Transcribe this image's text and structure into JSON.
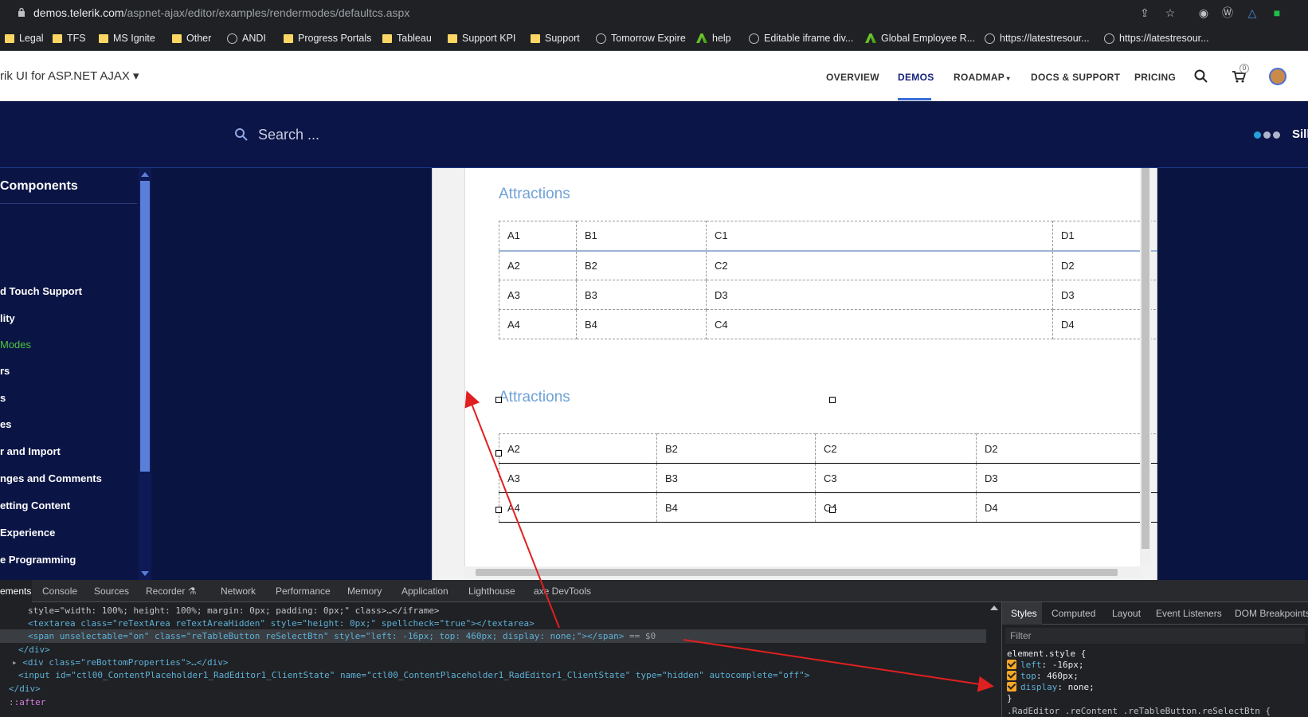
{
  "browser": {
    "url_host": "demos.telerik.com",
    "url_path": "/aspnet-ajax/editor/examples/rendermodes/defaultcs.aspx",
    "bookmarks": [
      {
        "label": "Legal",
        "icon": "folder-icon"
      },
      {
        "label": "TFS",
        "icon": "folder-icon"
      },
      {
        "label": "MS Ignite",
        "icon": "folder-icon"
      },
      {
        "label": "Other",
        "icon": "folder-icon"
      },
      {
        "label": "ANDI",
        "icon": "globe-icon"
      },
      {
        "label": "Progress Portals",
        "icon": "folder-icon"
      },
      {
        "label": "Tableau",
        "icon": "folder-icon"
      },
      {
        "label": "Support KPI",
        "icon": "folder-icon"
      },
      {
        "label": "Support",
        "icon": "folder-icon"
      },
      {
        "label": "Tomorrow Expire",
        "icon": "globe-icon"
      },
      {
        "label": "help",
        "icon": "app-icon"
      },
      {
        "label": "Editable iframe div...",
        "icon": "globe-icon"
      },
      {
        "label": "Global Employee R...",
        "icon": "app-icon"
      },
      {
        "label": "https://latestresour...",
        "icon": "globe-icon"
      },
      {
        "label": "https://latestresour...",
        "icon": "globe-icon"
      }
    ]
  },
  "site": {
    "brand": "rik UI for ASP.NET AJAX",
    "nav": [
      "OVERVIEW",
      "DEMOS",
      "ROADMAP",
      "DOCS & SUPPORT",
      "PRICING"
    ],
    "cart_count": "0",
    "search_placeholder": "Search ...",
    "theme_label": "Sill"
  },
  "sidebar": {
    "heading": "Components",
    "items": [
      {
        "label": "d Touch Support",
        "active": false
      },
      {
        "label": "lity",
        "active": false
      },
      {
        "label": "Modes",
        "active": true
      },
      {
        "label": "rs",
        "active": false
      },
      {
        "label": "s",
        "active": false
      },
      {
        "label": "es",
        "active": false
      },
      {
        "label": "r and Import",
        "active": false
      },
      {
        "label": "nges and Comments",
        "active": false
      },
      {
        "label": "etting Content",
        "active": false
      },
      {
        "label": "Experience",
        "active": false
      },
      {
        "label": "e Programming",
        "active": false
      }
    ]
  },
  "editor": {
    "heading1": "Attractions",
    "table1": [
      [
        "A1",
        "B1",
        "C1",
        "D1"
      ],
      [
        "A2",
        "B2",
        "C2",
        "D2"
      ],
      [
        "A3",
        "B3",
        "D3",
        "D3"
      ],
      [
        "A4",
        "B4",
        "C4",
        "D4"
      ]
    ],
    "heading2": "Attractions",
    "table2": [
      [
        "A2",
        "B2",
        "C2",
        "D2"
      ],
      [
        "A3",
        "B3",
        "C3",
        "D3"
      ],
      [
        "A4",
        "B4",
        "C4",
        "D4"
      ]
    ]
  },
  "devtools": {
    "tabs": [
      "ements",
      "Console",
      "Sources",
      "Recorder",
      "Network",
      "Performance",
      "Memory",
      "Application",
      "Lighthouse",
      "axe DevTools"
    ],
    "code": {
      "line1": "style=\"width: 100%; height: 100%; margin: 0px; padding: 0px;\" class>…</iframe>",
      "line2": "<textarea class=\"reTextArea reTextAreaHidden\" style=\"height: 0px;\" spellcheck=\"true\"></textarea>",
      "line3": "<span unselectable=\"on\" class=\"reTableButton reSelectBtn\" style=\"left: -16px; top: 460px; display: none;\"></span>",
      "line3_suffix": "== $0",
      "line4": "</div>",
      "line5": "<div class=\"reBottomProperties\">…</div>",
      "line6": "<input id=\"ctl00_ContentPlaceholder1_RadEditor1_ClientState\" name=\"ctl00_ContentPlaceholder1_RadEditor1_ClientState\" type=\"hidden\" autocomplete=\"off\">",
      "line7": "</div>",
      "line8": "::after"
    },
    "styles_tabs": [
      "Styles",
      "Computed",
      "Layout",
      "Event Listeners",
      "DOM Breakpoints"
    ],
    "filter_placeholder": "Filter",
    "rule_selector": "element.style {",
    "rule_props": [
      {
        "prop": "left",
        "value": "-16px;"
      },
      {
        "prop": "top",
        "value": "460px;"
      },
      {
        "prop": "display",
        "value": "none;"
      }
    ],
    "rule_close": "}",
    "next_rule": ".RadEditor .reContent .reTableButton.reSelectBtn {"
  },
  "colors": {
    "page_bg": "#0a1440",
    "accent_blue": "#3b6fd8",
    "sidebar_active": "#4cc43f",
    "heading_blue": "#6fa2d6",
    "annotation_red": "#e02020"
  }
}
